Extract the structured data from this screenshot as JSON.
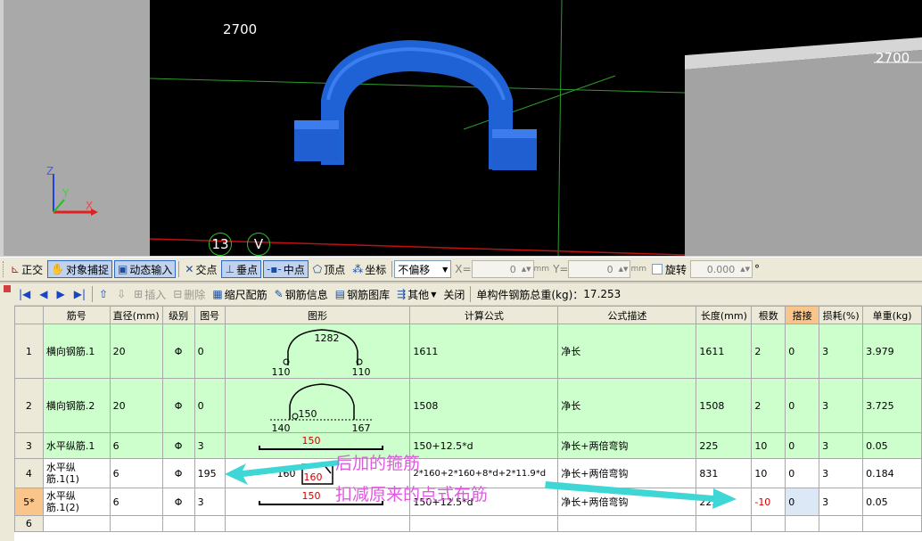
{
  "viewport": {
    "dim_left": "2700",
    "dim_right": "2700",
    "axis_z": "Z",
    "axis_y": "Y",
    "axis_x": "X",
    "snap_number": "13",
    "snap_letter": "V"
  },
  "toolbar": {
    "ortho": "正交",
    "object_snap": "对象捕捉",
    "dynamic_input": "动态输入",
    "intersection": "交点",
    "perpendicular": "垂点",
    "midpoint": "中点",
    "vertex": "顶点",
    "coordinate": "坐标",
    "offset_mode": "不偏移",
    "x_label": "X=",
    "x_value": "0",
    "y_label": "Y=",
    "y_value": "0",
    "unit_mm": "mm",
    "rotate": "旋转",
    "rotate_value": "0.000",
    "degree": "°"
  },
  "rebar_toolbar": {
    "insert": "插入",
    "delete": "删除",
    "scale_rebar": "缩尺配筋",
    "rebar_info": "钢筋信息",
    "rebar_library": "钢筋图库",
    "other": "其他",
    "close": "关闭",
    "total_weight_label": "单构件钢筋总重(kg)：",
    "total_weight": "17.253"
  },
  "table": {
    "columns": [
      "筋号",
      "直径(mm)",
      "级别",
      "图号",
      "图形",
      "计算公式",
      "公式描述",
      "长度(mm)",
      "根数",
      "搭接",
      "损耗(%)",
      "单重(kg)"
    ],
    "rows": [
      {
        "num": "1",
        "name": "横向钢筋.1",
        "dia": "20",
        "grade": "Φ",
        "fig": "0",
        "formula": "1611",
        "desc": "净长",
        "length": "1611",
        "count": "2",
        "lap": "0",
        "loss": "3",
        "weight": "3.979",
        "s1": "1282",
        "s2": "110",
        "s3": "110"
      },
      {
        "num": "2",
        "name": "横向钢筋.2",
        "dia": "20",
        "grade": "Φ",
        "fig": "0",
        "formula": "1508",
        "desc": "净长",
        "length": "1508",
        "count": "2",
        "lap": "0",
        "loss": "3",
        "weight": "3.725",
        "s1": "150",
        "s2": "140",
        "s3": "167"
      },
      {
        "num": "3",
        "name": "水平纵筋.1",
        "dia": "6",
        "grade": "Φ",
        "fig": "3",
        "formula": "150+12.5*d",
        "desc": "净长+两倍弯钩",
        "length": "225",
        "count": "10",
        "lap": "0",
        "loss": "3",
        "weight": "0.05",
        "s1": "150"
      },
      {
        "num": "4",
        "name": "水平纵筋.1(1)",
        "dia": "6",
        "grade": "Φ",
        "fig": "195",
        "formula": "2*160+2*160+8*d+2*11.9*d",
        "desc": "净长+两倍弯钩",
        "length": "831",
        "count": "10",
        "lap": "0",
        "loss": "3",
        "weight": "0.184",
        "s1": "160",
        "s2": "160"
      },
      {
        "num": "5*",
        "name": "水平纵筋.1(2)",
        "dia": "6",
        "grade": "Φ",
        "fig": "3",
        "formula": "150+12.5*d",
        "desc": "净长+两倍弯钩",
        "length": "225",
        "count": "-10",
        "lap": "0",
        "loss": "3",
        "weight": "0.05",
        "s1": "150"
      },
      {
        "num": "6"
      }
    ]
  },
  "annotation": {
    "line1": "后加的箍筋",
    "line2": "扣减原来的点式布筋"
  }
}
